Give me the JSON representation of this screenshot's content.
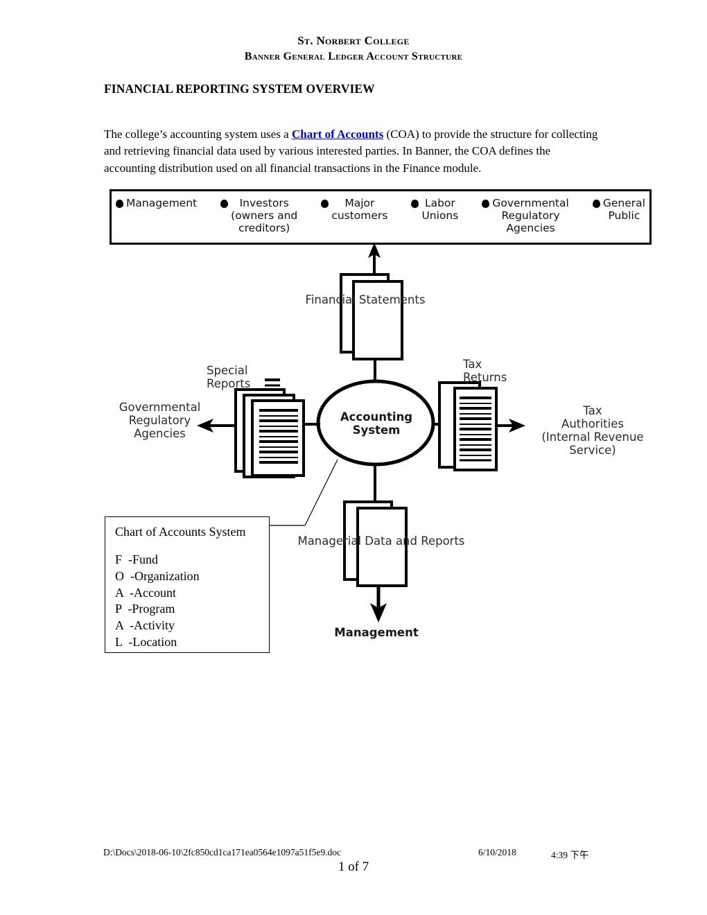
{
  "document": {
    "header": {
      "institution": "St. Norbert College",
      "subtitle": "Banner General Ledger Account Structure"
    },
    "section_title": "FINANCIAL REPORTING SYSTEM OVERVIEW",
    "paragraph": {
      "before_link": "The college’s accounting system uses a ",
      "link_text": "Chart of Accounts",
      "after_link": " (COA) to provide the structure for collecting and retrieving financial data used by various interested parties.  In Banner, the COA defines the accounting distribution used on all financial transactions in the Finance module.",
      "link_color": "#0000cc"
    }
  },
  "figure": {
    "stakeholders": [
      {
        "label": "Management",
        "align": "left"
      },
      {
        "label": "Investors\n(owners and\ncreditors)",
        "align": "center"
      },
      {
        "label": "Major\ncustomers",
        "align": "center"
      },
      {
        "label": "Labor\nUnions",
        "align": "center"
      },
      {
        "label": "Governmental\nRegulatory\nAgencies",
        "align": "center"
      },
      {
        "label": "General\nPublic",
        "align": "center"
      }
    ],
    "nodes": {
      "financial_statements": "Financial Statements",
      "special_reports": "Special\nReports",
      "tax_returns": "Tax\nReturns",
      "governmental_regulatory_agencies": "Governmental\nRegulatory\nAgencies",
      "tax_authorities": "Tax\nAuthorities\n(Internal Revenue\nService)",
      "accounting_system": "Accounting\nSystem",
      "managerial_data": "Managerial Data and Reports",
      "management": "Management"
    }
  },
  "callout": {
    "title": "Chart of Accounts System",
    "items": [
      "F  -Fund",
      "O  -Organization",
      "A  -Account",
      "P  -Program",
      "A  -Activity",
      "L  -Location"
    ]
  },
  "footer": {
    "path": "D:\\Docs\\2018-06-10\\2fc850cd1ca171ea0564e1097a51f5e9.doc",
    "date": "6/10/2018",
    "time": "4:39 下午",
    "page": "1  of  7"
  }
}
